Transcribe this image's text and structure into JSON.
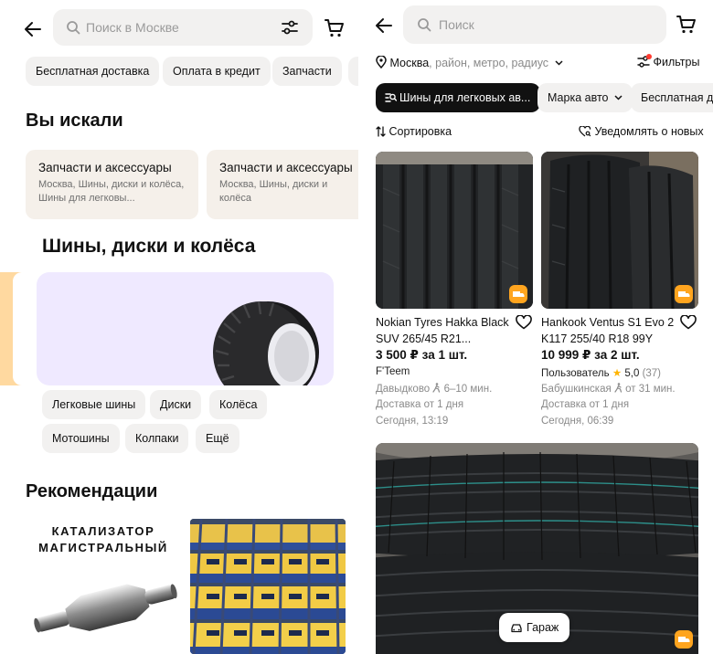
{
  "left": {
    "search_placeholder": "Поиск в Москве",
    "chips": [
      "Бесплатная доставка",
      "Оплата в кредит",
      "Запчасти"
    ],
    "section_searched": "Вы искали",
    "searched_cards": [
      {
        "title": "Запчасти и аксессуары",
        "subtitle": "Москва, Шины, диски и колёса, Шины для легковы..."
      },
      {
        "title": "Запчасти и аксессуары",
        "subtitle": "Москва, Шины, диски и колёса"
      }
    ],
    "category_title": "Шины, диски и колёса",
    "category_chips": [
      "Легковые шины",
      "Диски",
      "Колёса",
      "Мотошины",
      "Колпаки",
      "Ещё"
    ],
    "section_recommendations": "Рекомендации",
    "reco_card_text_line1": "КАТАЛИЗАТОР",
    "reco_card_text_line2": "МАГИСТРАЛЬНЫЙ"
  },
  "right": {
    "search_placeholder": "Поиск",
    "location": "Москва",
    "location_hint": ", район, метро, радиус",
    "filters_label": "Фильтры",
    "chips": [
      "Шины для легковых ав...",
      "Марка авто",
      "Бесплатная д"
    ],
    "sort_label": "Сортировка",
    "notify_label": "Уведомлять о новых",
    "products": [
      {
        "title": "Nokian Tyres Hakka Black SUV 265/45 R21...",
        "price": "3 500 ₽ за 1 шт.",
        "seller": "F'Teem",
        "rating": "",
        "reviews": "",
        "metro": "Давыдково",
        "walk": "6–10 мин.",
        "delivery": "Доставка от 1 дня",
        "date": "Сегодня, 13:19"
      },
      {
        "title": "Hankook Ventus S1 Evo 2 K117 255/40 R18 99Y",
        "price": "10 999 ₽ за 2 шт.",
        "seller": "Пользователь",
        "rating": "5,0",
        "reviews": "(37)",
        "metro": "Бабушкинская",
        "walk": "от 31 мин.",
        "delivery": "Доставка от 1 дня",
        "date": "Сегодня, 06:39"
      }
    ],
    "garage_label": "Гараж"
  },
  "colors": {
    "accent_orange": "#ffa51f",
    "chip_bg": "#f2f1f0",
    "dark_chip": "#111111",
    "star": "#ffb400",
    "banner_lilac": "#efe9ff"
  }
}
